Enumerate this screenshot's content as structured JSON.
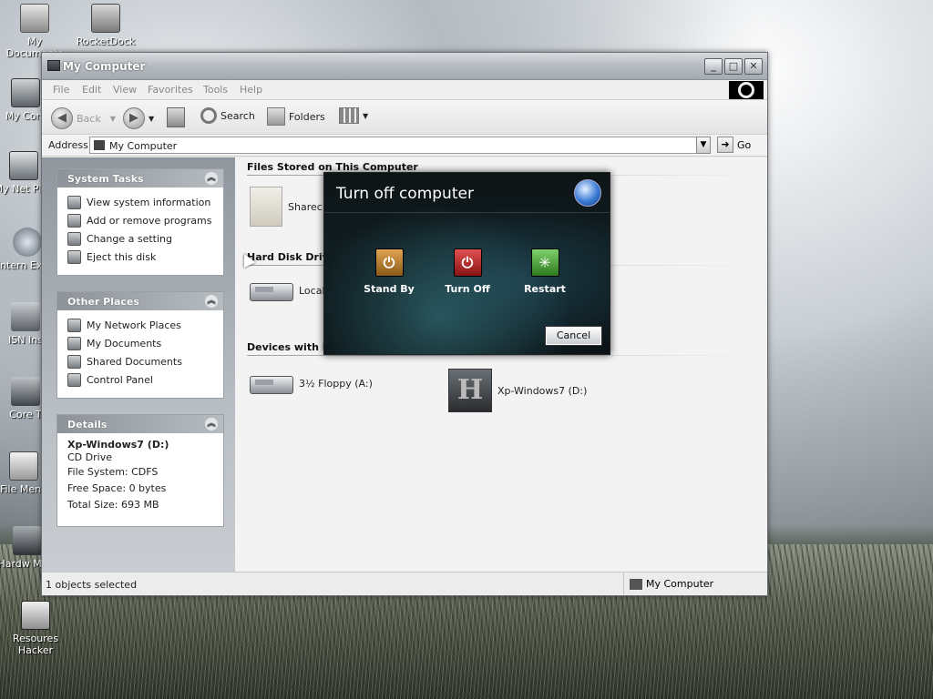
{
  "desktop": {
    "icons": [
      {
        "label": "My Documents"
      },
      {
        "label": "RocketDock"
      },
      {
        "label": "My Com"
      },
      {
        "label": "My Net Plac"
      },
      {
        "label": "Intern Explo"
      },
      {
        "label": "ISN Ins"
      },
      {
        "label": "Core T"
      },
      {
        "label": "File Menu"
      },
      {
        "label": "Hardw Moni"
      },
      {
        "label": "Resoures Hacker"
      }
    ]
  },
  "window": {
    "title": "My Computer",
    "buttons": {
      "minimize": "_",
      "maximize": "□",
      "close": "✕"
    },
    "menu": [
      "File",
      "Edit",
      "View",
      "Favorites",
      "Tools",
      "Help"
    ],
    "toolbar": {
      "back": "Back",
      "search": "Search",
      "folders": "Folders"
    },
    "address": {
      "label": "Address",
      "value": "My Computer",
      "go": "Go"
    },
    "system_tasks": {
      "title": "System Tasks",
      "items": [
        "View system information",
        "Add or remove programs",
        "Change a setting",
        "Eject this disk"
      ]
    },
    "other_places": {
      "title": "Other Places",
      "items": [
        "My Network Places",
        "My Documents",
        "Shared Documents",
        "Control Panel"
      ]
    },
    "details": {
      "title": "Details",
      "name": "Xp-Windows7 (D:)",
      "type": "CD Drive",
      "file_system": "File System: CDFS",
      "free_space": "Free Space: 0 bytes",
      "total_size": "Total Size: 693 MB"
    },
    "sections": {
      "files_stored": "Files Stored on This Computer",
      "hard_disk": "Hard Disk Drive",
      "devices": "Devices with Re"
    },
    "items": {
      "shared": "Sharec",
      "local": "Local D",
      "floppy": "3½ Floppy (A:)",
      "cd": "Xp-Windows7 (D:)"
    },
    "status": {
      "left": "1 objects selected",
      "right": "My Computer"
    }
  },
  "turn_off_dialog": {
    "title": "Turn off computer",
    "standby": "Stand By",
    "turnoff": "Turn Off",
    "restart": "Restart",
    "cancel": "Cancel"
  }
}
